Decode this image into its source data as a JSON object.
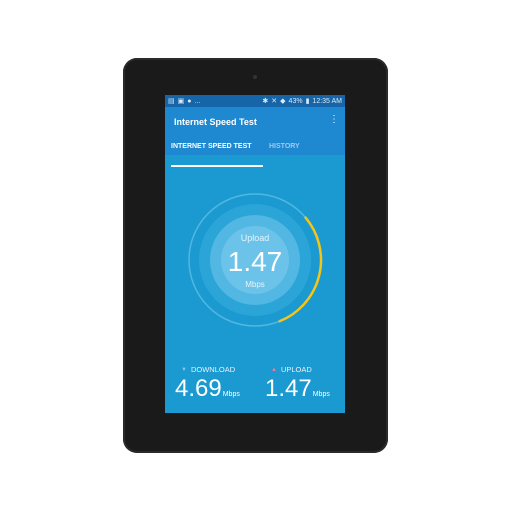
{
  "statusbar": {
    "left_icons": [
      "notification-icon",
      "notification-icon",
      "app-icon",
      "more-notifications"
    ],
    "left_text": "...",
    "battery": "43%",
    "time": "12:35 AM"
  },
  "appbar": {
    "title": "Internet Speed Test",
    "menu_glyph": "⋮",
    "tabs": [
      {
        "label": "INTERNET SPEED TEST",
        "active": true
      },
      {
        "label": "HISTORY",
        "active": false
      }
    ]
  },
  "gauge": {
    "mode_label": "Upload",
    "value": "1.47",
    "unit": "Mbps",
    "progress": 0.3,
    "arc_color": "#f5c518"
  },
  "results": {
    "download": {
      "label": "DOWNLOAD",
      "value": "4.69",
      "unit": "Mbps",
      "icon": "arrow-down-icon"
    },
    "upload": {
      "label": "UPLOAD",
      "value": "1.47",
      "unit": "Mbps",
      "icon": "arrow-up-icon"
    }
  },
  "colors": {
    "statusbar": "#1565a8",
    "appbar": "#1e88d0",
    "screen": "#1a9ad0",
    "accent": "#f5c518"
  }
}
